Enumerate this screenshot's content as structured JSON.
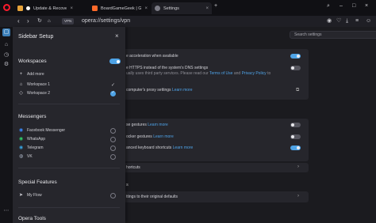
{
  "browser": {
    "tabs": [
      {
        "label": "Update & Recovery",
        "color": "#3b6fd6"
      },
      {
        "label": "BoardGameGeek | Gaming",
        "color": "#ff6a2a"
      },
      {
        "label": "Settings",
        "color": "#7b7b85"
      }
    ],
    "vpn_label": "VPN",
    "url": "opera://settings/vpn"
  },
  "settings": {
    "search_placeholder": "Search settings",
    "rows": {
      "hw_accel": "e acceleration when available",
      "dns_line1": "e HTTPS instead of the system's DNS settings",
      "dns_line2": "ually uses third party services. Please read our",
      "dns_terms": "Terms of Use",
      "dns_and": "and",
      "dns_privacy": "Privacy Policy",
      "dns_to": "to",
      "proxy": "computer's proxy settings",
      "proxy_link": "Learn more",
      "gestures": "se gestures",
      "gestures_link": "Learn more",
      "rocker": "ocker gestures",
      "rocker_link": "Learn more",
      "shortcuts": "anced keyboard shortcuts",
      "shortcuts_link": "Learn more",
      "shortcuts2": "hortcuts",
      "reset_head": "s",
      "reset": "ttings to their original defaults"
    }
  },
  "panel": {
    "title": "Sidebar Setup",
    "workspaces": {
      "heading": "Workspaces",
      "add_more": "Add more",
      "items": [
        "Workspace 1",
        "Workspace 2"
      ]
    },
    "messengers": {
      "heading": "Messengers",
      "items": [
        "Facebook Messenger",
        "WhatsApp",
        "Telegram",
        "VK"
      ]
    },
    "special": {
      "heading": "Special Features",
      "items": [
        "My Flow"
      ]
    },
    "opera_tools": {
      "heading": "Opera Tools"
    }
  },
  "colors": {
    "accent": "#4ea3e6",
    "opera_red": "#ff1b2d"
  }
}
